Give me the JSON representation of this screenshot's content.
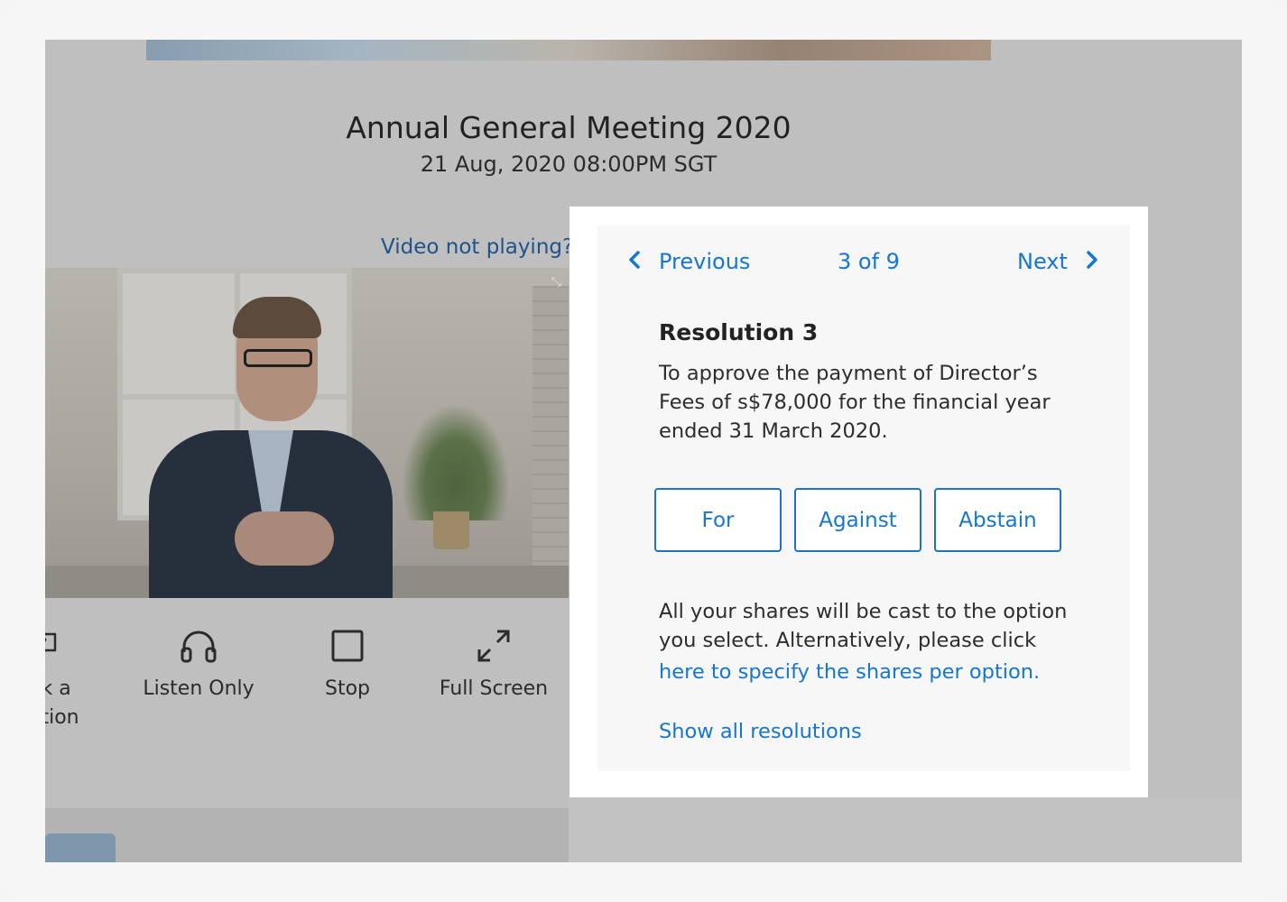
{
  "meeting": {
    "title": "Annual General Meeting 2020",
    "datetime": "21 Aug, 2020 08:00PM SGT"
  },
  "video": {
    "help_link": "Video not playing?",
    "controls": {
      "ask_question": "sk a\nstion",
      "listen_only": "Listen Only",
      "stop": "Stop",
      "full_screen": "Full Screen"
    }
  },
  "resolution_panel": {
    "prev_label": "Previous",
    "counter": "3 of 9",
    "next_label": "Next",
    "title": "Resolution 3",
    "description": "To approve the payment of Director’s Fees of s$78,000 for the financial year ended 31 March 2020.",
    "options": {
      "for": "For",
      "against": "Against",
      "abstain": "Abstain"
    },
    "note": "All your shares will be cast to the option you select. Alternatively, please click",
    "specify_link": "here to specify the shares per option.",
    "show_all_link": "Show all resolutions"
  },
  "icons": {
    "prev": "chevron-left-icon",
    "next": "chevron-right-icon",
    "ask": "question-bubble-icon",
    "listen": "headphones-icon",
    "stop": "stop-square-icon",
    "fullscreen": "expand-arrows-icon"
  },
  "colors": {
    "accent": "#1676d0",
    "overlay": "#bfbfbf"
  }
}
